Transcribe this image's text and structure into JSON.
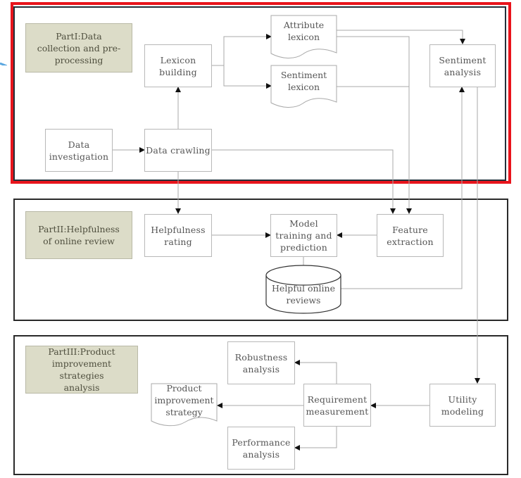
{
  "diagram": {
    "sections": [
      {
        "id": "part1",
        "label": "PartI:Data\ncollection and pre-\nprocessing",
        "highlighted": true,
        "highlight_color": "#e8141c"
      },
      {
        "id": "part2",
        "label": "PartII:Helpfulness\nof online review",
        "highlighted": false
      },
      {
        "id": "part3",
        "label": "PartIII:Product\nimprovement strategies\nanalysis",
        "highlighted": false
      }
    ],
    "nodes": {
      "lexicon_building": "Lexicon\nbuilding",
      "data_investigation": "Data\ninvestigation",
      "data_crawling": "Data crawling",
      "attribute_lexicon": "Attribute\nlexicon",
      "sentiment_lexicon": "Sentiment\nlexicon",
      "sentiment_analysis": "Sentiment\nanalysis",
      "helpfulness_rating": "Helpfulness\nrating",
      "model_training": "Model\ntraining and\nprediction",
      "feature_extraction": "Feature\nextraction",
      "helpful_reviews": "Helpful online\nreviews",
      "robustness_analysis": "Robustness\nanalysis",
      "product_strategy": "Product\nimprovement\nstrategy",
      "requirement_measurement": "Requirement\nmeasurement",
      "utility_modeling": "Utility\nmodeling",
      "performance_analysis": "Performance\nanalysis"
    },
    "edges": [
      {
        "from": "data_investigation",
        "to": "data_crawling"
      },
      {
        "from": "data_crawling",
        "to": "lexicon_building"
      },
      {
        "from": "lexicon_building",
        "to": "attribute_lexicon"
      },
      {
        "from": "lexicon_building",
        "to": "sentiment_lexicon"
      },
      {
        "from": "attribute_lexicon",
        "to": "sentiment_analysis"
      },
      {
        "from": "attribute_lexicon",
        "to": "feature_extraction"
      },
      {
        "from": "sentiment_lexicon",
        "to": "feature_extraction"
      },
      {
        "from": "data_crawling",
        "to": "feature_extraction"
      },
      {
        "from": "data_crawling",
        "to": "helpfulness_rating"
      },
      {
        "from": "helpfulness_rating",
        "to": "model_training"
      },
      {
        "from": "feature_extraction",
        "to": "model_training"
      },
      {
        "from": "model_training",
        "to": "helpful_reviews"
      },
      {
        "from": "helpful_reviews",
        "to": "sentiment_analysis"
      },
      {
        "from": "sentiment_analysis",
        "to": "utility_modeling"
      },
      {
        "from": "utility_modeling",
        "to": "requirement_measurement"
      },
      {
        "from": "requirement_measurement",
        "to": "robustness_analysis"
      },
      {
        "from": "requirement_measurement",
        "to": "performance_analysis"
      },
      {
        "from": "requirement_measurement",
        "to": "product_strategy"
      }
    ]
  }
}
